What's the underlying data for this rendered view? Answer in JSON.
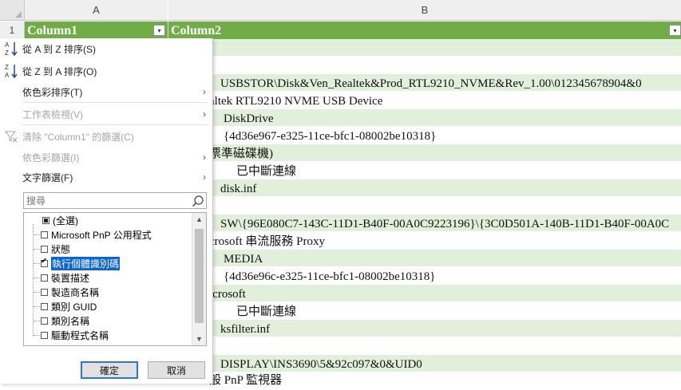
{
  "columns": {
    "a": "A",
    "b": "B"
  },
  "row_numbers": {
    "r1": "1"
  },
  "header_row": {
    "col1": "Column1",
    "col2": "Column2",
    "filter_glyph": "▾"
  },
  "visible_cells": [
    "USBSTOR\\Disk&Ven_Realtek&Prod_RTL9210_NVME&Rev_1.00\\012345678904&0",
    "altek RTL9210 NVME USB Device",
    "DiskDrive",
    "{4d36e967-e325-11ce-bfc1-08002be10318}",
    "票準磁碟機)",
    "已中斷連線",
    "disk.inf",
    "SW\\{96E080C7-143C-11D1-B40F-00A0C9223196}\\{3C0D501A-140B-11D1-B40F-00A0C",
    "crosoft 串流服務 Proxy",
    "MEDIA",
    "{4d36e96c-e325-11ce-bfc1-08002be10318}",
    "icrosoft",
    "已中斷連線",
    "ksfilter.inf",
    "DISPLAY\\INS3690\\5&92c097&0&UID0",
    "般 PnP 監視器"
  ],
  "filter_menu": {
    "sort_az": "從 A 到 Z 排序(S)",
    "sort_za": "從 Z 到 A 排序(O)",
    "sort_by_color": "依色彩排序(T)",
    "sheet_view": "工作表檢視(V)",
    "clear_filter": "清除 \"Column1\" 的篩選(C)",
    "filter_by_color": "依色彩篩選(I)",
    "text_filters": "文字篩選(F)",
    "arrow": "›",
    "search_placeholder": "搜尋",
    "items": [
      {
        "label": "(全選)",
        "state": "partial"
      },
      {
        "label": "Microsoft PnP 公用程式",
        "state": "unchecked"
      },
      {
        "label": "狀態",
        "state": "unchecked"
      },
      {
        "label": "執行個體識別碼",
        "state": "checked"
      },
      {
        "label": "裝置描述",
        "state": "unchecked"
      },
      {
        "label": "製造商名稱",
        "state": "unchecked"
      },
      {
        "label": "類別 GUID",
        "state": "unchecked"
      },
      {
        "label": "類別名稱",
        "state": "unchecked"
      },
      {
        "label": "驅動程式名稱",
        "state": "unchecked"
      }
    ],
    "ok_label": "確定",
    "cancel_label": "取消"
  },
  "colors": {
    "header_green": "#70ad47",
    "band_green": "#e2efda",
    "selection_blue": "#0a64d8"
  }
}
